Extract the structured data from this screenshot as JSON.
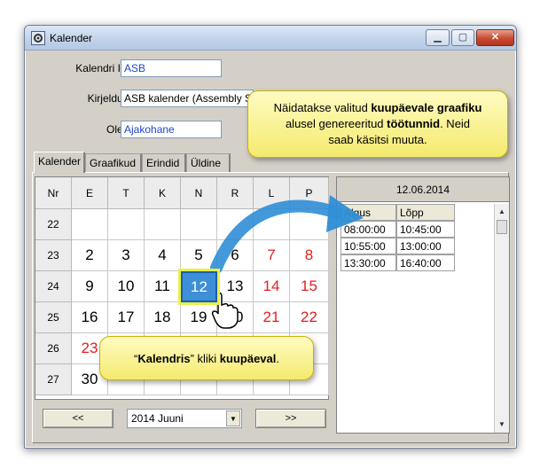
{
  "window": {
    "title": "Kalender"
  },
  "form": {
    "id_label": "Kalendri ID:",
    "id_value": "ASB",
    "desc_label": "Kirjeldus:",
    "desc_value": "ASB kalender (Assembly S",
    "state_label": "Olek:",
    "state_value": "Ajakohane"
  },
  "tabs": [
    {
      "label": "Kalender"
    },
    {
      "label": "Graafikud"
    },
    {
      "label": "Erindid"
    },
    {
      "label": "Üldine"
    }
  ],
  "calendar": {
    "headers": [
      "Nr",
      "E",
      "T",
      "K",
      "N",
      "R",
      "L",
      "P"
    ],
    "weeks": [
      {
        "nr": "22",
        "days": [
          "",
          "",
          "",
          "",
          "",
          "",
          ""
        ]
      },
      {
        "nr": "23",
        "days": [
          "2",
          "3",
          "4",
          "5",
          "6",
          "7",
          "8"
        ]
      },
      {
        "nr": "24",
        "days": [
          "9",
          "10",
          "11",
          "12",
          "13",
          "14",
          "15"
        ]
      },
      {
        "nr": "25",
        "days": [
          "16",
          "17",
          "18",
          "19",
          "20",
          "21",
          "22"
        ]
      },
      {
        "nr": "26",
        "days": [
          "23",
          "",
          "",
          "",
          "",
          "",
          "9"
        ]
      },
      {
        "nr": "27",
        "days": [
          "30",
          "",
          "",
          "",
          "",
          "",
          ""
        ]
      }
    ],
    "selected_day": "12",
    "prev_label": "<<",
    "next_label": ">>",
    "month": "2014 Juuni"
  },
  "day_panel": {
    "date": "12.06.2014",
    "col_start": "Algus",
    "col_end": "Lõpp",
    "rows": [
      {
        "start": "08:00:00",
        "end": "10:45:00"
      },
      {
        "start": "10:55:00",
        "end": "13:00:00"
      },
      {
        "start": "13:30:00",
        "end": "16:40:00"
      }
    ]
  },
  "callout_top": {
    "t1": "Näidatakse valitud ",
    "b1": "kuupäevale graafiku",
    "t2": "alusel genereeritud ",
    "b2": "töötunnid",
    "t3": ". Neid",
    "t4": "saab käsitsi muuta."
  },
  "callout_bottom": {
    "q1": "“",
    "b1": "Kalendris",
    "t1": "” kliki ",
    "b2": "kuupäeval",
    "t2": "."
  },
  "colors": {
    "accent": "#3d8fd8",
    "weekend": "#e02020",
    "callout": "#f4ea6e",
    "arrow": "#2f8ed6"
  }
}
